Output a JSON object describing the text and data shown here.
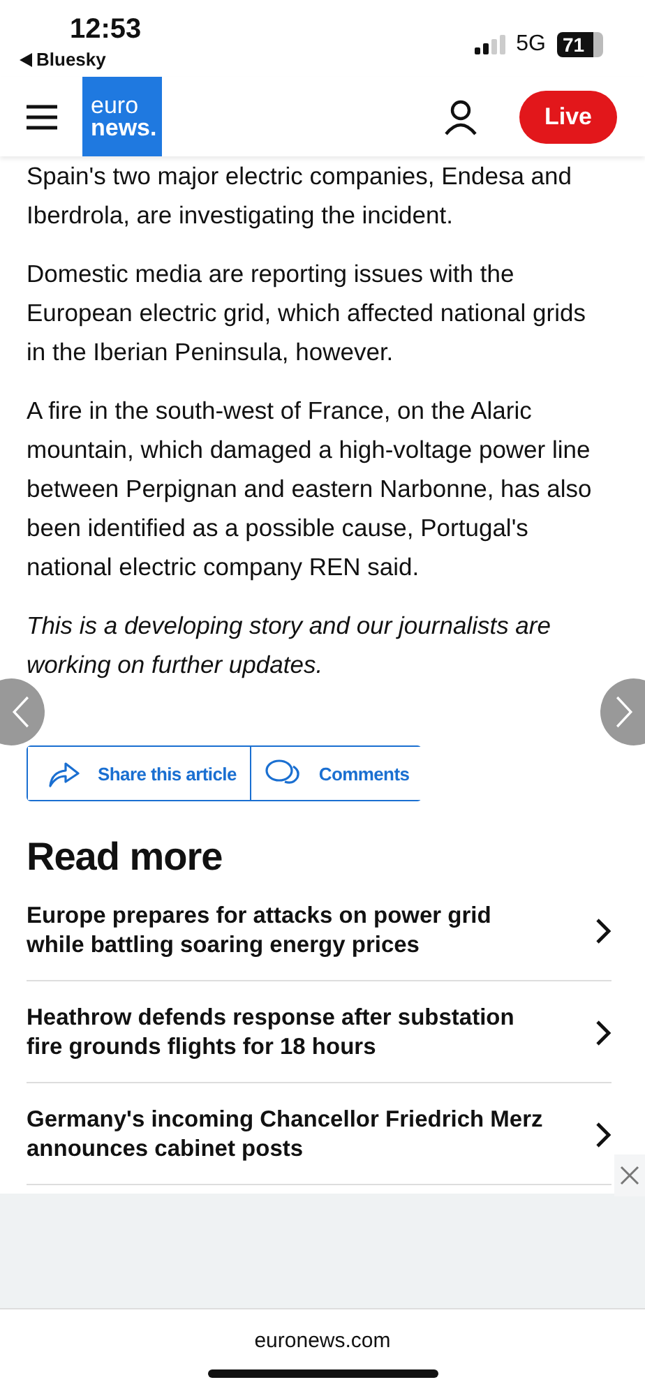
{
  "status_bar": {
    "time": "12:53",
    "back_label": "Bluesky",
    "network": "5G",
    "battery": "71"
  },
  "header": {
    "logo_top": "euro",
    "logo_bottom": "news.",
    "live_label": "Live"
  },
  "article": {
    "paragraphs": [
      {
        "text": "Spain's two major electric companies, Endesa and Iberdrola, are investigating the incident.",
        "italic": false
      },
      {
        "text": "Domestic media are reporting issues with the European electric grid, which affected national grids in the Iberian Peninsula, however.",
        "italic": false
      },
      {
        "text": "A fire in the south-west of France, on the Alaric mountain, which damaged a high-voltage power line between Perpignan and eastern Narbonne, has also been identified as a possible cause, Portugal's national electric company REN said.",
        "italic": false
      },
      {
        "text": "This is a developing story and our journalists are working on further updates.",
        "italic": true
      }
    ],
    "actions": [
      "Share this article",
      "Comments"
    ]
  },
  "read_more": {
    "heading": "Read more",
    "items": [
      {
        "title": "Europe prepares for attacks on power grid while battling soaring energy prices"
      },
      {
        "title": "Heathrow defends response after substation fire grounds flights for 18 hours"
      },
      {
        "title": "Germany's incoming Chancellor Friedrich Merz announces cabinet posts"
      }
    ]
  },
  "address_bar": {
    "domain": "euronews.com"
  }
}
